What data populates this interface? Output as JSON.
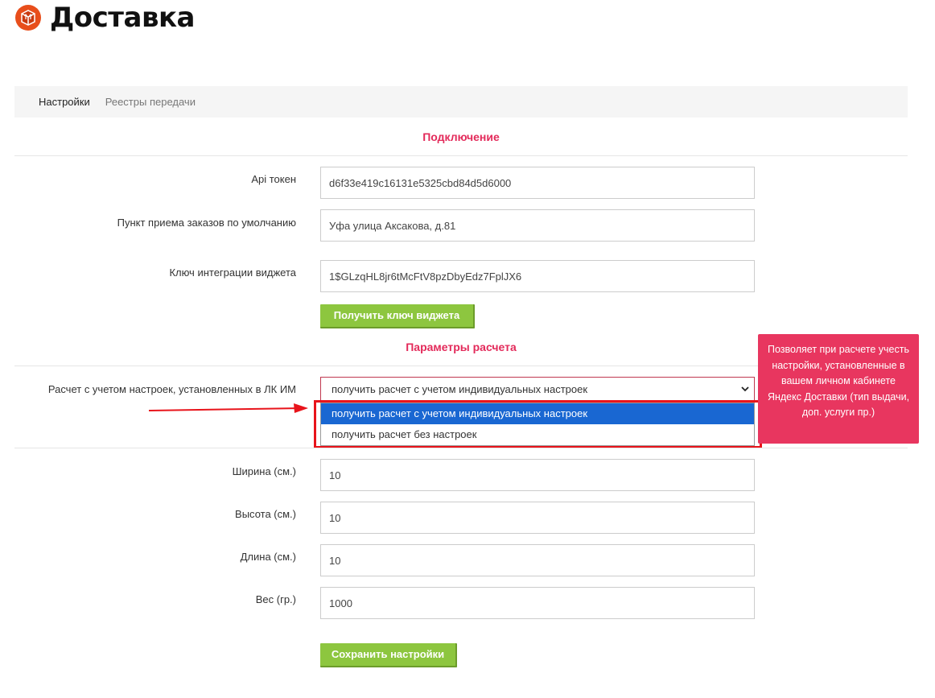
{
  "header": {
    "brand": "Доставка",
    "logo_icon": "box-icon"
  },
  "tabs": [
    {
      "label": "Настройки",
      "active": true
    },
    {
      "label": "Реестры передачи",
      "active": false
    }
  ],
  "sections": {
    "connection_title": "Подключение",
    "calc_title": "Параметры расчета"
  },
  "connection": {
    "api_token": {
      "label": "Api токен",
      "value": "d6f33e419c16131e5325cbd84d5d6000"
    },
    "pickup_point": {
      "label": "Пункт приема заказов по умолчанию",
      "value": "Уфа улица Аксакова, д.81"
    },
    "widget_key": {
      "label": "Ключ интеграции виджета",
      "value": "1$GLzqHL8jr6tMcFtV8pzDbyEdz7FplJX6"
    },
    "get_key_button": "Получить ключ виджета"
  },
  "calc": {
    "mode_label": "Расчет с учетом настроек, установленных в ЛК ИМ",
    "mode_selected": "получить расчет с учетом индивидуальных настроек",
    "options": [
      "получить расчет с учетом индивидуальных настроек",
      "получить расчет без настроек"
    ],
    "tooltip": "Позволяет при расчете учесть настройки, установленные в вашем личном кабинете Яндекс Доставки (тип выдачи, доп. услуги пр.)",
    "width": {
      "label": "Ширина (см.)",
      "value": "10"
    },
    "height": {
      "label": "Высота (см.)",
      "value": "10"
    },
    "length": {
      "label": "Длина (см.)",
      "value": "10"
    },
    "weight": {
      "label": "Вес (гр.)",
      "value": "1000"
    },
    "save_button": "Сохранить настройки"
  },
  "colors": {
    "accent": "#e32a5a",
    "button": "#8dc63f",
    "tooltip": "#e8365f",
    "highlight": "#e8141b",
    "selected_option": "#1967d2"
  }
}
